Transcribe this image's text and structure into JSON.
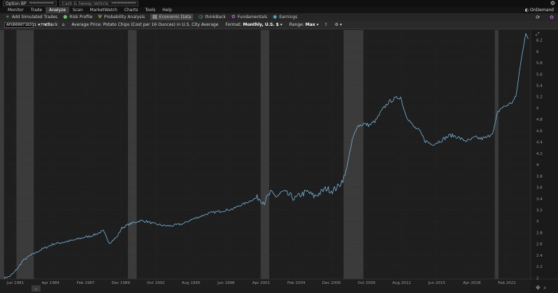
{
  "account": {
    "label": "Option BP",
    "value": "**************",
    "sweep_label": "Cash & Sweep Vehicle",
    "sweep_value": "**************"
  },
  "menu": {
    "items": [
      "Monitor",
      "Trade",
      "Analyze",
      "Scan",
      "MarketWatch",
      "Charts",
      "Tools",
      "Help"
    ],
    "active": "Analyze",
    "ondemand": "OnDemand"
  },
  "toolbar": {
    "items": [
      {
        "label": "Add Simulated Trades",
        "icon": "plus-icon"
      },
      {
        "label": "Risk Profile",
        "icon": "risk-profile-icon"
      },
      {
        "label": "Probability Analysis",
        "icon": "probability-icon"
      },
      {
        "label": "Economic Data",
        "icon": "economic-data-icon",
        "active": true
      },
      {
        "label": "thinkBack",
        "icon": "thinkback-icon"
      },
      {
        "label": "Fundamentals",
        "icon": "fundamentals-icon"
      },
      {
        "label": "Earnings",
        "icon": "earnings-icon"
      }
    ]
  },
  "nav": {
    "symbol": "APU0000718311 (FRED)",
    "back": "Back",
    "study_title": "Average Price: Potato Chips (Cost per 16 Ounces) in U.S. City Average",
    "format_label": "Format:",
    "format_value": "Monthly, U.S. $",
    "range_label": "Range:",
    "range_value": "Max"
  },
  "chart_data": {
    "type": "line",
    "title": "Average Price: Potato Chips (Cost per 16 Ounces) in U.S. City Average",
    "x_tick_labels": [
      "Jun 1981",
      "Apr 1984",
      "Feb 1987",
      "Dec 1989",
      "Oct 1992",
      "Aug 1995",
      "Jun 1998",
      "Apr 2001",
      "Feb 2004",
      "Dec 2006",
      "Oct 2009",
      "Aug 2012",
      "Jun 2015",
      "Apr 2018",
      "Feb 2021"
    ],
    "y_ticks": [
      2,
      2.2,
      2.4,
      2.6,
      2.8,
      3,
      3.2,
      3.4,
      3.6,
      3.8,
      4,
      4.2,
      4.4,
      4.6,
      4.8,
      5,
      5.2,
      5.4,
      5.6,
      5.8,
      6,
      6.2
    ],
    "ylim": [
      1.98,
      6.38
    ],
    "xlim": [
      1980.4,
      2023.0
    ],
    "recessions": [
      [
        1980.0,
        1980.5
      ],
      [
        1981.5,
        1982.9
      ],
      [
        1990.5,
        1991.2
      ],
      [
        2001.2,
        2001.9
      ],
      [
        2007.9,
        2009.5
      ],
      [
        2020.1,
        2020.4
      ]
    ],
    "line_color": "#6fa6c9",
    "points": [
      [
        1980.5,
        2.0
      ],
      [
        1980.9,
        2.02
      ],
      [
        1981.3,
        2.09
      ],
      [
        1981.7,
        2.2
      ],
      [
        1982.0,
        2.3
      ],
      [
        1982.5,
        2.38
      ],
      [
        1983.0,
        2.44
      ],
      [
        1983.5,
        2.5
      ],
      [
        1984.0,
        2.55
      ],
      [
        1984.5,
        2.6
      ],
      [
        1985.0,
        2.62
      ],
      [
        1985.5,
        2.64
      ],
      [
        1986.0,
        2.66
      ],
      [
        1986.5,
        2.69
      ],
      [
        1987.0,
        2.72
      ],
      [
        1987.5,
        2.74
      ],
      [
        1988.0,
        2.78
      ],
      [
        1988.5,
        2.83
      ],
      [
        1989.0,
        2.62
      ],
      [
        1989.6,
        2.72
      ],
      [
        1990.0,
        2.88
      ],
      [
        1990.5,
        2.94
      ],
      [
        1991.0,
        2.98
      ],
      [
        1991.5,
        3.01
      ],
      [
        1992.0,
        3.0
      ],
      [
        1992.5,
        2.96
      ],
      [
        1993.0,
        2.94
      ],
      [
        1993.5,
        2.92
      ],
      [
        1994.0,
        2.92
      ],
      [
        1994.5,
        2.94
      ],
      [
        1995.0,
        2.96
      ],
      [
        1995.5,
        3.02
      ],
      [
        1996.0,
        3.06
      ],
      [
        1996.5,
        3.1
      ],
      [
        1997.0,
        3.14
      ],
      [
        1997.5,
        3.16
      ],
      [
        1998.0,
        3.18
      ],
      [
        1998.5,
        3.2
      ],
      [
        1999.0,
        3.22
      ],
      [
        1999.5,
        3.28
      ],
      [
        2000.0,
        3.32
      ],
      [
        2000.5,
        3.38
      ],
      [
        2001.0,
        3.42
      ],
      [
        2001.5,
        3.34
      ],
      [
        2002.0,
        3.5
      ],
      [
        2002.5,
        3.44
      ],
      [
        2003.0,
        3.52
      ],
      [
        2003.5,
        3.46
      ],
      [
        2004.0,
        3.4
      ],
      [
        2004.5,
        3.48
      ],
      [
        2005.0,
        3.52
      ],
      [
        2005.5,
        3.44
      ],
      [
        2006.0,
        3.5
      ],
      [
        2006.5,
        3.58
      ],
      [
        2007.0,
        3.54
      ],
      [
        2007.5,
        3.62
      ],
      [
        2008.0,
        3.8
      ],
      [
        2008.3,
        4.1
      ],
      [
        2008.6,
        4.44
      ],
      [
        2009.0,
        4.68
      ],
      [
        2009.5,
        4.72
      ],
      [
        2010.0,
        4.7
      ],
      [
        2010.5,
        4.78
      ],
      [
        2011.0,
        4.96
      ],
      [
        2011.5,
        5.1
      ],
      [
        2012.0,
        5.16
      ],
      [
        2012.5,
        5.2
      ],
      [
        2012.8,
        4.96
      ],
      [
        2013.0,
        4.86
      ],
      [
        2013.5,
        4.68
      ],
      [
        2014.0,
        4.6
      ],
      [
        2014.5,
        4.42
      ],
      [
        2015.0,
        4.36
      ],
      [
        2015.5,
        4.4
      ],
      [
        2016.0,
        4.46
      ],
      [
        2016.5,
        4.52
      ],
      [
        2017.0,
        4.5
      ],
      [
        2017.5,
        4.44
      ],
      [
        2018.0,
        4.42
      ],
      [
        2018.5,
        4.48
      ],
      [
        2019.0,
        4.46
      ],
      [
        2019.5,
        4.48
      ],
      [
        2020.0,
        4.6
      ],
      [
        2020.3,
        4.9
      ],
      [
        2020.6,
        5.0
      ],
      [
        2021.0,
        5.04
      ],
      [
        2021.5,
        5.1
      ],
      [
        2021.8,
        5.2
      ],
      [
        2022.0,
        5.5
      ],
      [
        2022.2,
        5.8
      ],
      [
        2022.4,
        6.08
      ],
      [
        2022.6,
        6.34
      ],
      [
        2022.8,
        6.22
      ]
    ]
  }
}
